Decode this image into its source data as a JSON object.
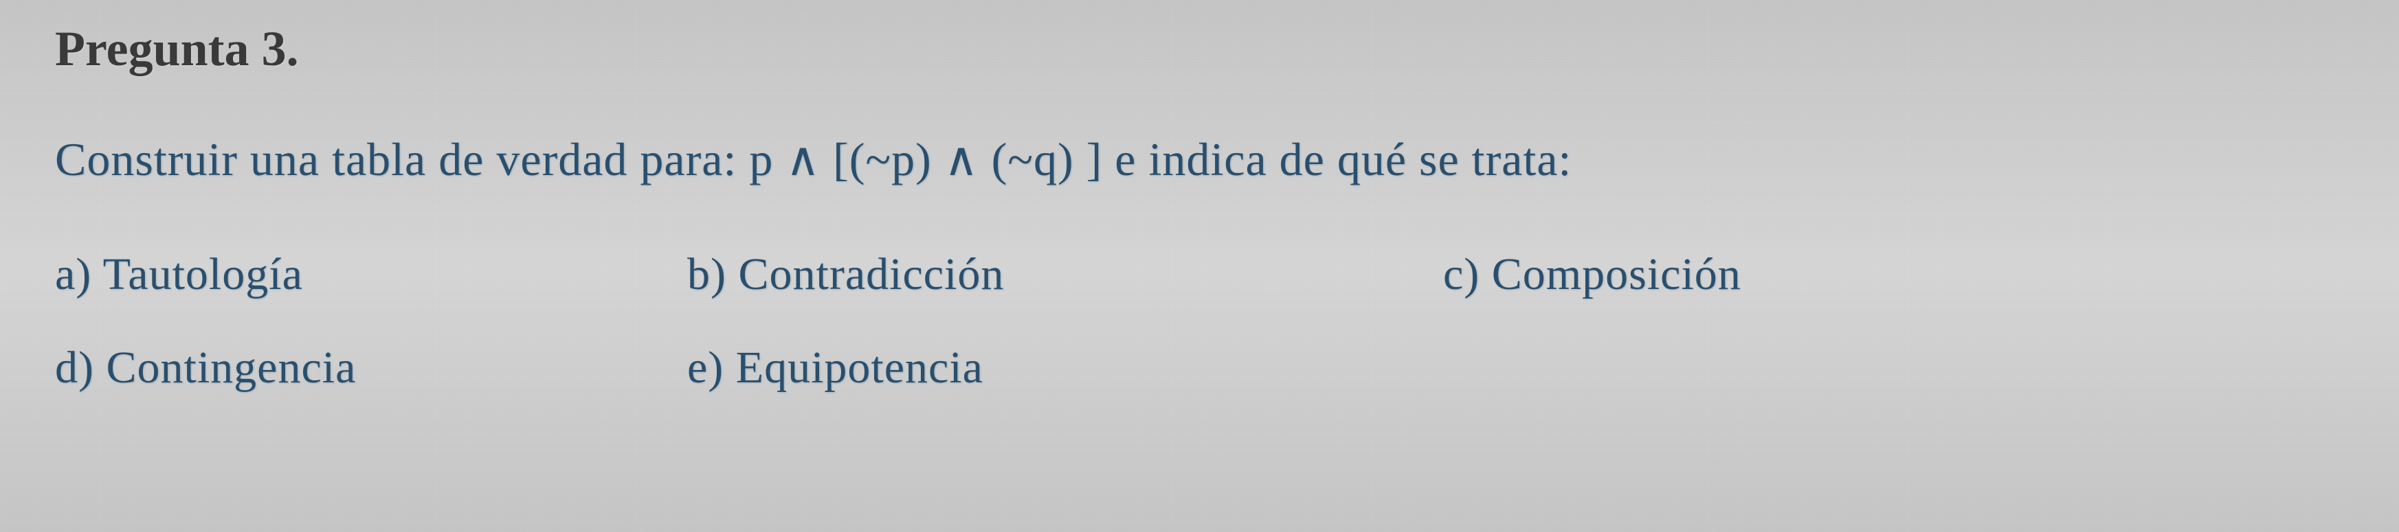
{
  "question": {
    "title": "Pregunta 3.",
    "text": "Construir una tabla de verdad para: p ∧ [(~p) ∧ (~q) ] e indica de qué se trata:"
  },
  "options": {
    "a": "a) Tautología",
    "b": "b) Contradicción",
    "c": "c) Composición",
    "d": "d) Contingencia",
    "e": "e) Equipotencia"
  }
}
